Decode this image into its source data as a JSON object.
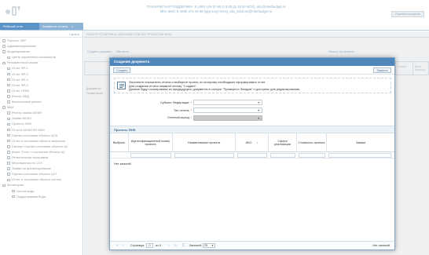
{
  "header": {
    "support_line1": "ТЕХНИЧЕСКАЯ ПОДДЕРЖКА: 8 (499) 126-37-80 (с 9:00 до 18:00 МСК), abc@interbudget.ru",
    "support_line2": "МКА ЖКХ: 8 (499) 371-26-98 (круглосуточно), abc_krasnov@interbudget.ru",
    "right_button": "Перейти на портал"
  },
  "tabs": [
    {
      "label": "Рабочий стол"
    },
    {
      "label": "Заявки на отчеты",
      "close": "×"
    }
  ],
  "sidebar": {
    "top_label": "Скрыть",
    "items": [
      {
        "label": "Расчеты ЗФР"
      },
      {
        "label": "Администрирование"
      },
      {
        "label": "Моделирование"
      },
      {
        "label": "Центр управления конфликтов"
      },
      {
        "label": "Регламентный режим"
      },
      {
        "label": "Отчет ФР-1"
      },
      {
        "label": "Отчет ФР-2"
      },
      {
        "label": "Отчет ФР-3"
      },
      {
        "label": "Отчет ФР-4"
      },
      {
        "label": "Отчет ОПЕК"
      },
      {
        "label": "Реестр МКД"
      },
      {
        "label": "Капитальный ремонт"
      },
      {
        "label": "МКИ"
      },
      {
        "label": "Реестр заявок МОКИ"
      },
      {
        "label": "Заявки МСАН"
      },
      {
        "label": "Проекты ФНБ"
      },
      {
        "label": "Отчеты МОКИ ВП МКИ"
      },
      {
        "label": "Оценка состояния объекта ЦСВ"
      },
      {
        "label": "Отчет о состоянии объекта мероприя"
      },
      {
        "label": "Паспорт Оценка состояния объекта ЦС"
      },
      {
        "label": "Визит. Отчет о состоянии объекта ЦС"
      },
      {
        "label": "Региональная программа"
      },
      {
        "label": "Мероприятия по ССК"
      },
      {
        "label": "Заявки на финансирование"
      },
      {
        "label": "Оценка состояния объекта ЦСТ"
      },
      {
        "label": "Отчет о состоянии объекта систем"
      },
      {
        "label": "Мониторинг"
      },
      {
        "label": "Чистая вода"
      },
      {
        "label": "Подпрограмма Вода"
      }
    ]
  },
  "main": {
    "head": "РЕЕСТР ОТЧЕТНЫХ ДОКУМЕНТОВ ПО ПРОЕКТАМ ФНБ",
    "toolbar_create": "Создать документ",
    "toolbar_refresh": "Обновить",
    "filter_label": "Фильтр по проекту",
    "ghost_cols": [
      "Номер",
      "Дата регистр"
    ],
    "side_label1": "Документы",
    "side_label2": "Примечание"
  },
  "modal": {
    "title": "Создание документа",
    "create_button": "Создать",
    "close_button": "Закрыть",
    "info_line1": "Заполните показатели отчета и выберите проект, по которому необходимо сформировать отчет.",
    "info_line2": "Для создания отчета нажмите кнопку \"Создать\".",
    "info_line3": "Данные будут скопированы из предыдущего документа в статусе \"Проверено Фондом\" и доступны для редактирования.",
    "fields": [
      {
        "label": "Субъект Федерации:",
        "required": "*",
        "value": ""
      },
      {
        "label": "Тип отчета:",
        "required": "*",
        "value": ""
      },
      {
        "label": "Отчетный период:",
        "required": "*",
        "value": ""
      }
    ],
    "section_title": "Проекты ФНБ",
    "columns": [
      {
        "label": "Выбрать"
      },
      {
        "label": "Идентификационный номер проекта"
      },
      {
        "label": "Наименование проекта"
      },
      {
        "label": "ИКО"
      },
      {
        "label": "Сфера реализации"
      },
      {
        "label": "Стоимость проекта"
      },
      {
        "label": "Заявки"
      }
    ],
    "sort_indicator": "↑",
    "no_records": "Нет записей",
    "pager": {
      "first": "«",
      "prev": "‹",
      "page_label": "Страница",
      "page_value": "0",
      "of_label": "из 0",
      "next": "›",
      "last": "»",
      "refresh": "C",
      "per_page_label": "Записей:",
      "per_page_value": "25",
      "status": "Нет записей"
    }
  },
  "colors": {
    "header_blue": "#4f87bd",
    "tab_active": "#5b93c7",
    "accent_link": "#3f6f9a"
  }
}
